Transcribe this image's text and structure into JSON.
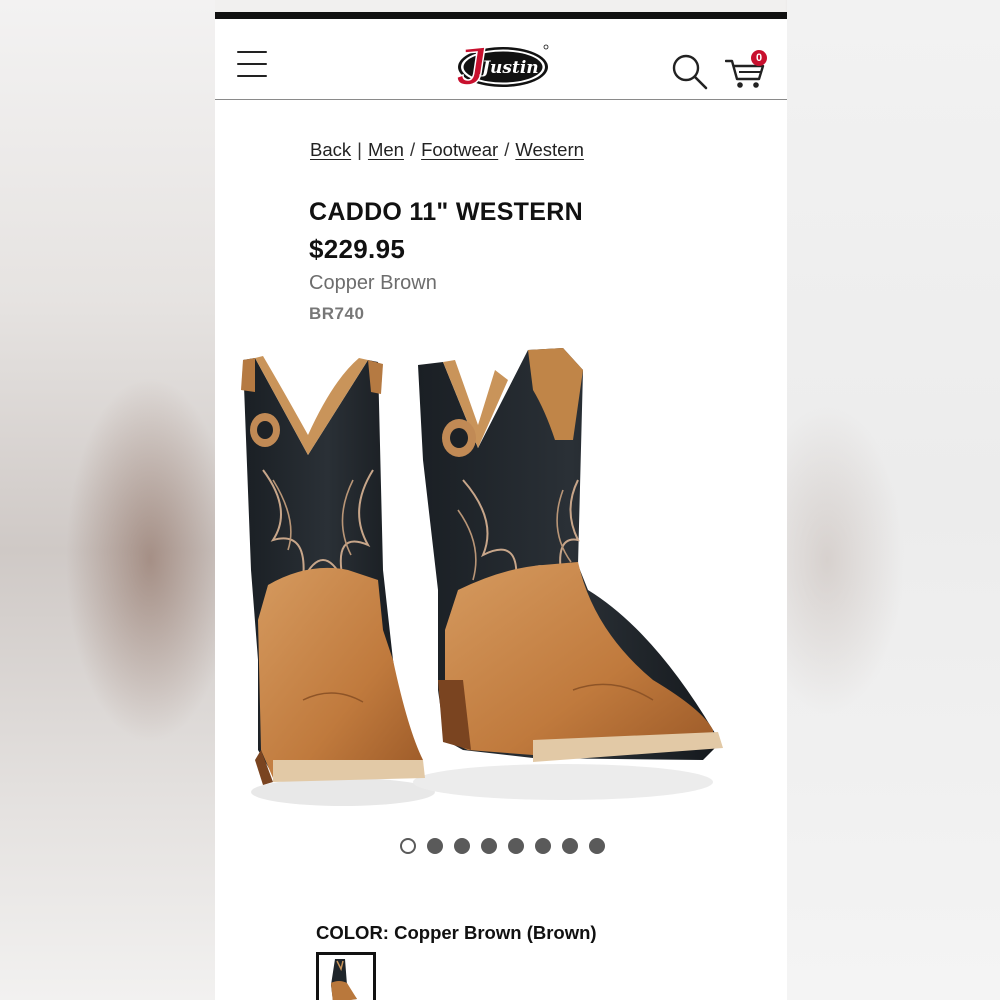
{
  "header": {
    "logo_text": "Justin",
    "cart_count": "0",
    "brand_color": "#c8102e"
  },
  "breadcrumb": {
    "back": "Back",
    "sep1": "|",
    "men": "Men",
    "sep2": "/",
    "footwear": "Footwear",
    "sep3": "/",
    "western": "Western"
  },
  "product": {
    "title": "CADDO 11\" WESTERN",
    "price": "$229.95",
    "color": "Copper Brown",
    "sku": "BR740",
    "color_label": "COLOR:",
    "color_value": "Copper Brown (Brown)",
    "image_count": 8,
    "active_image": 1
  },
  "icons": {
    "menu": "hamburger-menu-icon",
    "search": "search-icon",
    "cart": "cart-icon"
  }
}
